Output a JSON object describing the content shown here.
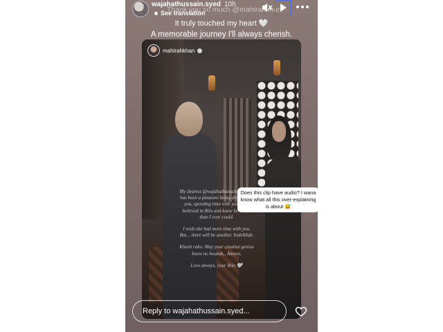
{
  "header": {
    "username": "wajahathussain.syed",
    "time": "10h",
    "see_translation": "See translation",
    "overlay_line_1": "Thank you so much @mahirahkhan"
  },
  "captions": {
    "line_2": "It truly touched my heart 🤍",
    "line_3": "A memorable journey I'll always cherish."
  },
  "reel": {
    "username": "mahirahkhan",
    "letter": [
      "My dearest @wajahathussain.syed , It has been a pleasure being directed by you, spending time with you.. you believed in Rilo and knew her more than I ever could.",
      "I wish she had more time with you. But... there will be another. InshAllah.",
      "Khush raho. May your creative genius know no bounds.. Ameen.",
      "Love always, your Rilo 🤍"
    ]
  },
  "comment": {
    "text": "Does this clip have audio? I wana know what all this over-explaining is about 😅"
  },
  "footer": {
    "reply_placeholder": "Reply to wajahathussain.syed..."
  },
  "icons": {
    "mute": "mute-icon",
    "play": "play-icon",
    "more": "more-icon",
    "heart": "heart-icon"
  },
  "colors": {
    "play_button_border": "#4f6fd6"
  }
}
